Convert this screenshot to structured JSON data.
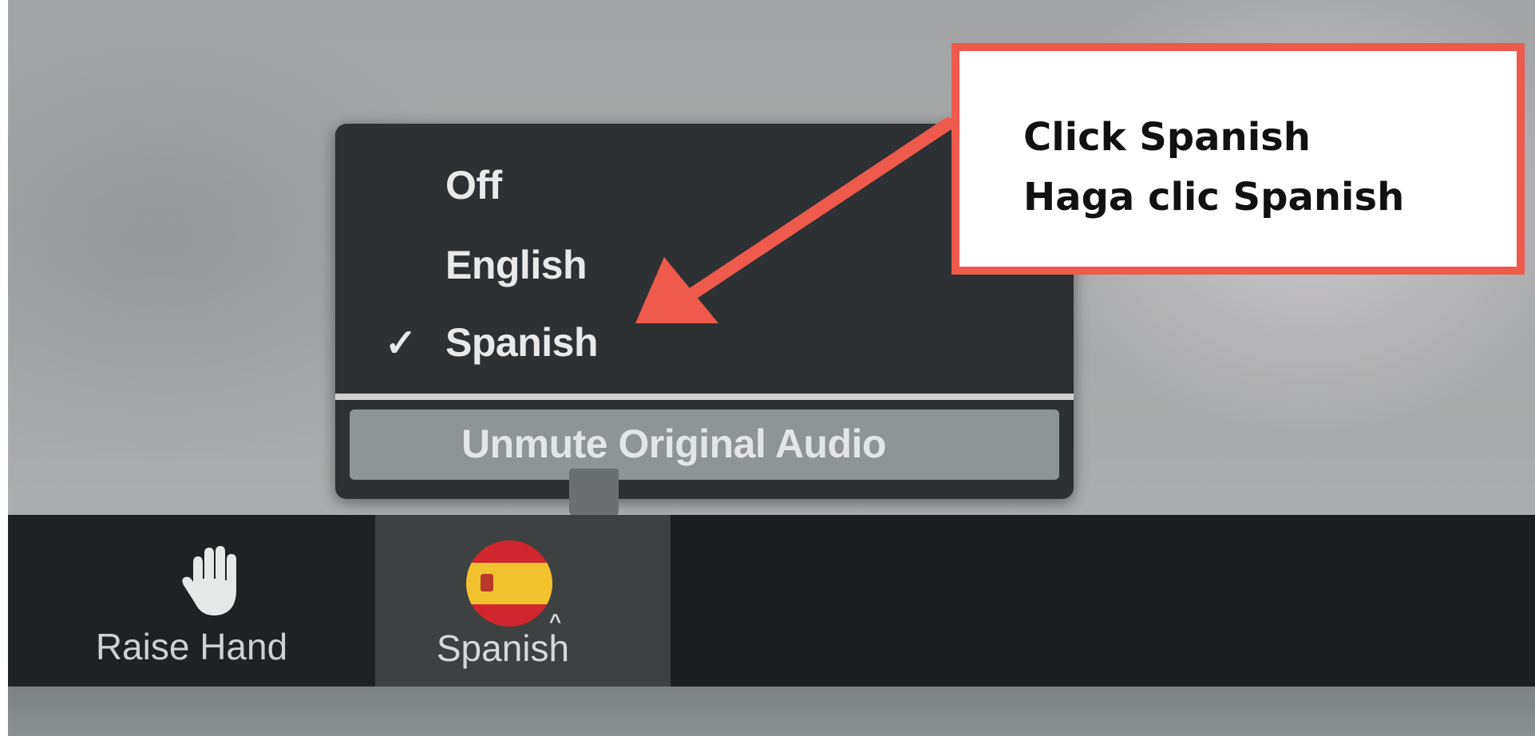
{
  "language_menu": {
    "items": [
      {
        "label": "Off",
        "selected": false
      },
      {
        "label": "English",
        "selected": false
      },
      {
        "label": "Spanish",
        "selected": true
      }
    ],
    "check_icon": "✓",
    "footer_action": "Unmute Original Audio"
  },
  "toolbar": {
    "raise_hand": {
      "label": "Raise Hand",
      "icon": "raised-hand-icon"
    },
    "language": {
      "label": "Spanish",
      "icon": "spain-flag-icon"
    }
  },
  "callout": {
    "line1": "Click Spanish",
    "line2": "Haga clic Spanish",
    "border_color": "#ee5a4c"
  }
}
